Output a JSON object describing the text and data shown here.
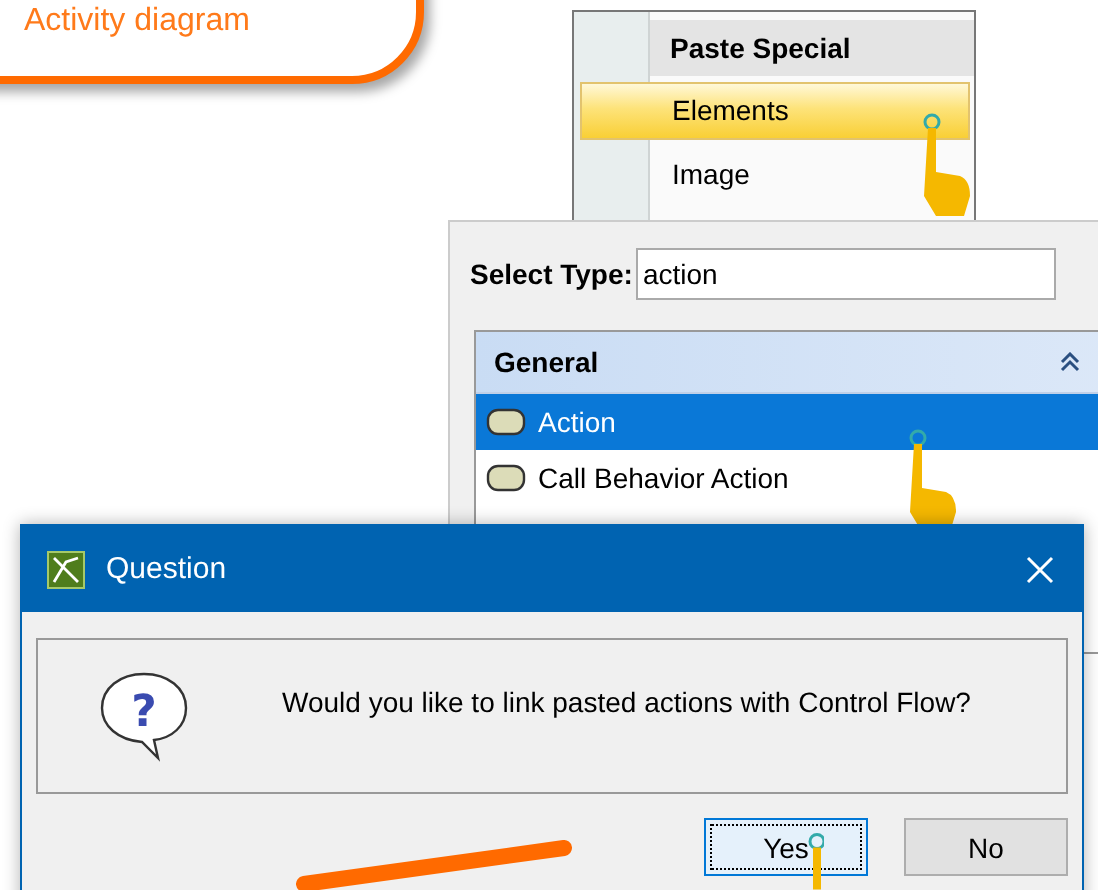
{
  "callout": {
    "text": "Activity diagram"
  },
  "context_menu": {
    "title": "Paste Special",
    "items": [
      {
        "label": "Elements",
        "selected": true
      },
      {
        "label": "Image",
        "selected": false
      }
    ]
  },
  "select_type": {
    "label": "Select Type:",
    "value": "action",
    "group": {
      "title": "General",
      "items": [
        {
          "label": "Action",
          "selected": true
        },
        {
          "label": "Call Behavior Action",
          "selected": false
        }
      ]
    }
  },
  "dialog": {
    "title": "Question",
    "icon_glyph": "?",
    "message": "Would you like to link pasted actions with Control Flow?",
    "buttons": [
      {
        "label": "Yes",
        "focused": true
      },
      {
        "label": "No",
        "focused": false
      }
    ]
  }
}
